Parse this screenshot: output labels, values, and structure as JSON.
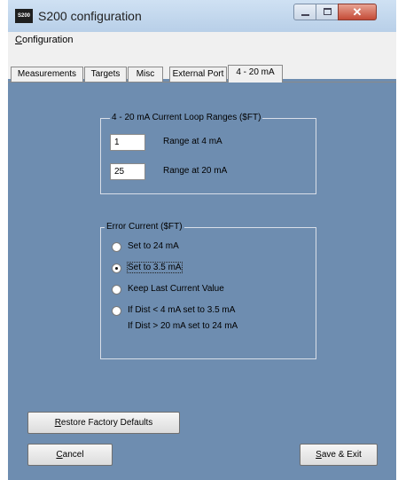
{
  "window": {
    "title": "S200 configuration",
    "app_icon_text": "S200",
    "close_glyph": "✕"
  },
  "menu": {
    "configuration": "Configuration"
  },
  "tabs": [
    "Measurements",
    "Targets",
    "Misc",
    "External Port",
    "4 - 20 mA"
  ],
  "active_tab": "4 - 20 mA",
  "ranges_group": {
    "legend": "4 - 20 mA Current Loop Ranges  ($FT)",
    "range_4_value": "1",
    "range_4_label": "Range at 4 mA",
    "range_20_value": "25",
    "range_20_label": "Range at 20 mA"
  },
  "error_group": {
    "legend": "Error Current  ($FT)",
    "options": [
      {
        "label": "Set to 24 mA",
        "selected": false
      },
      {
        "label": "Set to 3.5 mA",
        "selected": true
      },
      {
        "label": "Keep Last Current Value",
        "selected": false
      },
      {
        "label": "If Dist < 4 mA set to 3.5 mA",
        "selected": false
      }
    ],
    "option4_line2": "If Dist  > 20 mA set to 24 mA"
  },
  "buttons": {
    "restore": "Restore Factory Defaults",
    "cancel": "Cancel",
    "save_exit": "Save & Exit"
  }
}
